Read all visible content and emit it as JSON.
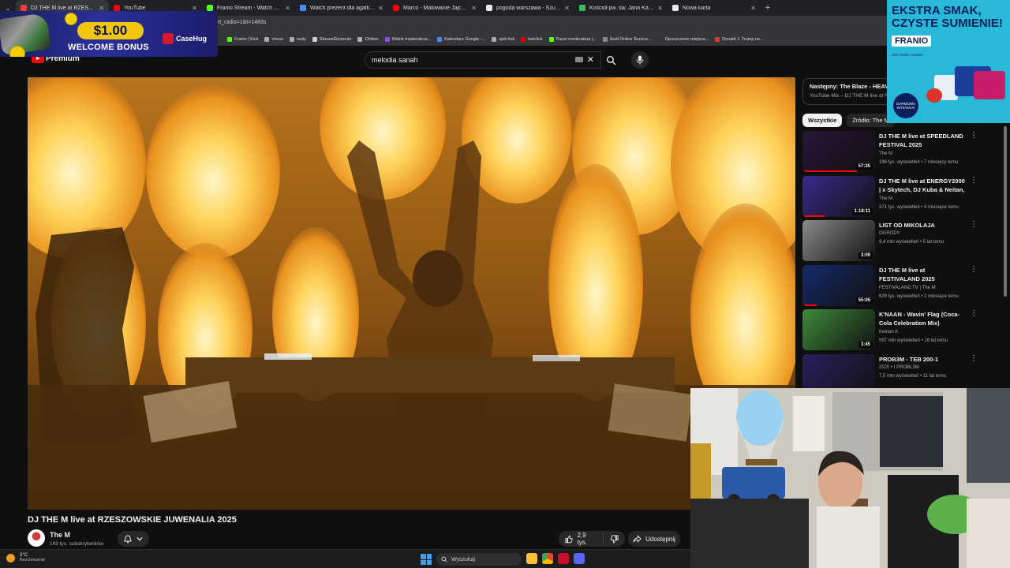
{
  "browser": {
    "tabs": [
      {
        "title": "DJ THE M live at RZESZOWSKI",
        "color": "#ff3a3a",
        "active": true
      },
      {
        "title": "YouTube",
        "color": "#ff0000"
      },
      {
        "title": "Franio Stream - Watch Live on",
        "color": "#53fc18"
      },
      {
        "title": "Watch prezent dla agatki, dark",
        "color": "#4a8cff"
      },
      {
        "title": "Marco - Malowanie Jajca (Paro",
        "color": "#ff0000"
      },
      {
        "title": "pogoda warszawa - Szukaj w G",
        "color": "#e8e8e8"
      },
      {
        "title": "Kościół pw. św. Jana Kantego",
        "color": "#3cba54"
      },
      {
        "title": "Nowa karta",
        "color": "#e8e8e8"
      }
    ],
    "url_fragment": "art_radio=1&t=1483s",
    "bookmarks": [
      {
        "label": "Franio | Kick",
        "color": "#53fc18"
      },
      {
        "label": "chess",
        "color": "#aaaaaa"
      },
      {
        "label": "nudy",
        "color": "#aaaaaa"
      },
      {
        "label": "StreamElements",
        "color": "#cccccc"
      },
      {
        "label": "Chilam",
        "color": "#aaaaaa"
      },
      {
        "label": "Widok moderatora...",
        "color": "#9146ff"
      },
      {
        "label": "Kalendarz Google -...",
        "color": "#4285f4"
      },
      {
        "label": "ujeb link",
        "color": "#aaaaaa"
      },
      {
        "label": "betclick",
        "color": "#e00000"
      },
      {
        "label": "Panel moderatora |...",
        "color": "#53fc18"
      },
      {
        "label": "Audi Online Service...",
        "color": "#888888"
      },
      {
        "label": "Opuszczone miejsca...",
        "color": "#333333"
      },
      {
        "label": "Donald J. Trump ne...",
        "color": "#d23b3b"
      }
    ]
  },
  "casino_ad": {
    "amount": "$1.00",
    "bonus": "WELCOME BONUS",
    "brand": "CaseHug"
  },
  "youtube": {
    "logo_text": "Premium",
    "search_value": "melodia sanah",
    "video": {
      "title": "DJ THE M live at RZESZOWSKIE JUWENALIA 2025",
      "channel": "The M",
      "subscribers": "169 tys. subskrybentów",
      "likes": "2,9 tys.",
      "share": "Udostępnij"
    },
    "up_next": {
      "label": "Następny: The Blaze - HEAVEN",
      "sub": "YouTube Mix – DJ THE M live at R"
    },
    "chips": [
      {
        "label": "Wszystkie",
        "active": true
      },
      {
        "label": "Źródło: The M",
        "active": false
      }
    ],
    "recommendations": [
      {
        "title": "DJ THE M live at SPEEDLAND FESTIVAL 2025",
        "channel": "The M",
        "meta": "196 tys. wyświetleń • 7 miesięcy temu",
        "duration": "57:35",
        "thumb": "#2a1438",
        "progress": 0.75
      },
      {
        "title": "DJ THE M live at ENERGY2000 | x Skytech, DJ Kuba & Neitan, C...",
        "channel": "The M",
        "meta": "371 tys. wyświetleń • 4 miesiące temu",
        "duration": "1:18:11",
        "thumb": "#3b2a8c",
        "progress": 0.3
      },
      {
        "title": "LIST OD MIKOLAJA",
        "channel": "OGRODY",
        "meta": "9,4 mln wyświetleń • 5 lat temu",
        "duration": "3:09",
        "thumb": "#8a8a8a",
        "progress": 0
      },
      {
        "title": "DJ THE M live at FESTIVALAND 2025",
        "channel": "FESTIVALAND TV | The M",
        "meta": "629 tys. wyświetleń • 2 miesiące temu",
        "duration": "55:05",
        "thumb": "#142a6a",
        "progress": 0.2
      },
      {
        "title": "K'NAAN - Wavin' Flag (Coca-Cola Celebration Mix)",
        "channel": "Keinan A",
        "meta": "597 mln wyświetleń • 16 lat temu",
        "duration": "3:45",
        "thumb": "#3f8a3a",
        "progress": 0
      },
      {
        "title": "PROB3M - TEB 200-1",
        "channel": "2020 • I PROBL3M",
        "meta": "7,5 mln wyświetleń • 11 lat temu",
        "duration": "",
        "thumb": "#2a1e5e",
        "progress": 0
      }
    ]
  },
  "food_ad": {
    "headline": "EKSTRA SMAK, CZYSTE SUMIENIE!",
    "brand": "FRANIO",
    "small": "10% zniżki z kodem",
    "badge": "DARMOWA WYSYŁKA!"
  },
  "taskbar": {
    "temp": "2°C",
    "weather": "Bezchmurnie",
    "search_placeholder": "Wyszukaj"
  }
}
